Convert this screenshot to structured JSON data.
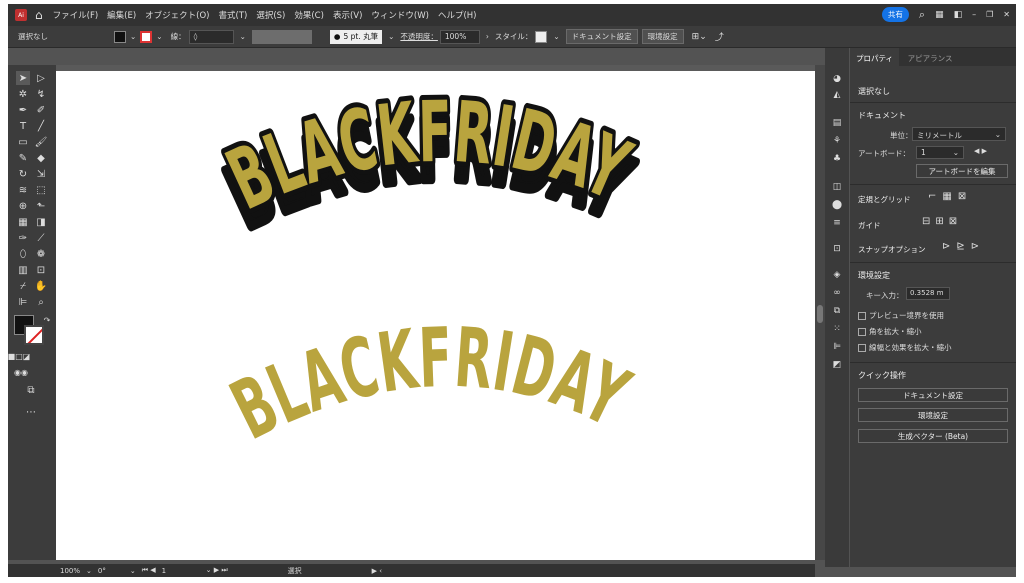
{
  "menubar": {
    "logo": "Ai",
    "items": [
      "ファイル(F)",
      "編集(E)",
      "オブジェクト(O)",
      "書式(T)",
      "選択(S)",
      "効果(C)",
      "表示(V)",
      "ウィンドウ(W)",
      "ヘルプ(H)"
    ],
    "share_label": "共有"
  },
  "control": {
    "selection_label": "選択なし",
    "stroke_label": "線：",
    "brush_label": "5 pt. 丸筆",
    "opacity_label": "不透明度：",
    "opacity_value": "100%",
    "style_label": "スタイル：",
    "doc_setup_label": "ドキュメント設定",
    "prefs_label": "環境設定"
  },
  "status": {
    "zoom": "100%",
    "rotation": "0°",
    "artboard_num": "1",
    "mode": "選択"
  },
  "artwork": {
    "top_text": "BLACKFRIDAY",
    "bottom_text": "BLACKFRIDAY",
    "fill_color": "#b9a43e",
    "outline_color": "#111111"
  },
  "panel": {
    "tabs": [
      "プロパティ",
      "アピアランス"
    ],
    "no_selection": "選択なし",
    "document_heading": "ドキュメント",
    "units_label": "単位：",
    "units_value": "ミリメートル",
    "artboard_label": "アートボード：",
    "artboard_value": "1",
    "edit_artboards_label": "アートボードを編集",
    "rulers_grid_label": "定規とグリッド",
    "guides_label": "ガイド",
    "snap_label": "スナップオプション",
    "prefs_heading": "環境設定",
    "key_increment_label": "キー入力：",
    "key_increment_value": "0.3528 m",
    "preview_bounds_label": "プレビュー境界を使用",
    "scale_corners_label": "角を拡大・縮小",
    "scale_strokes_label": "線幅と効果を拡大・縮小",
    "quick_actions_heading": "クイック操作",
    "quick_doc_setup": "ドキュメント設定",
    "quick_prefs": "環境設定",
    "quick_vector": "生成ベクター (Beta)"
  }
}
